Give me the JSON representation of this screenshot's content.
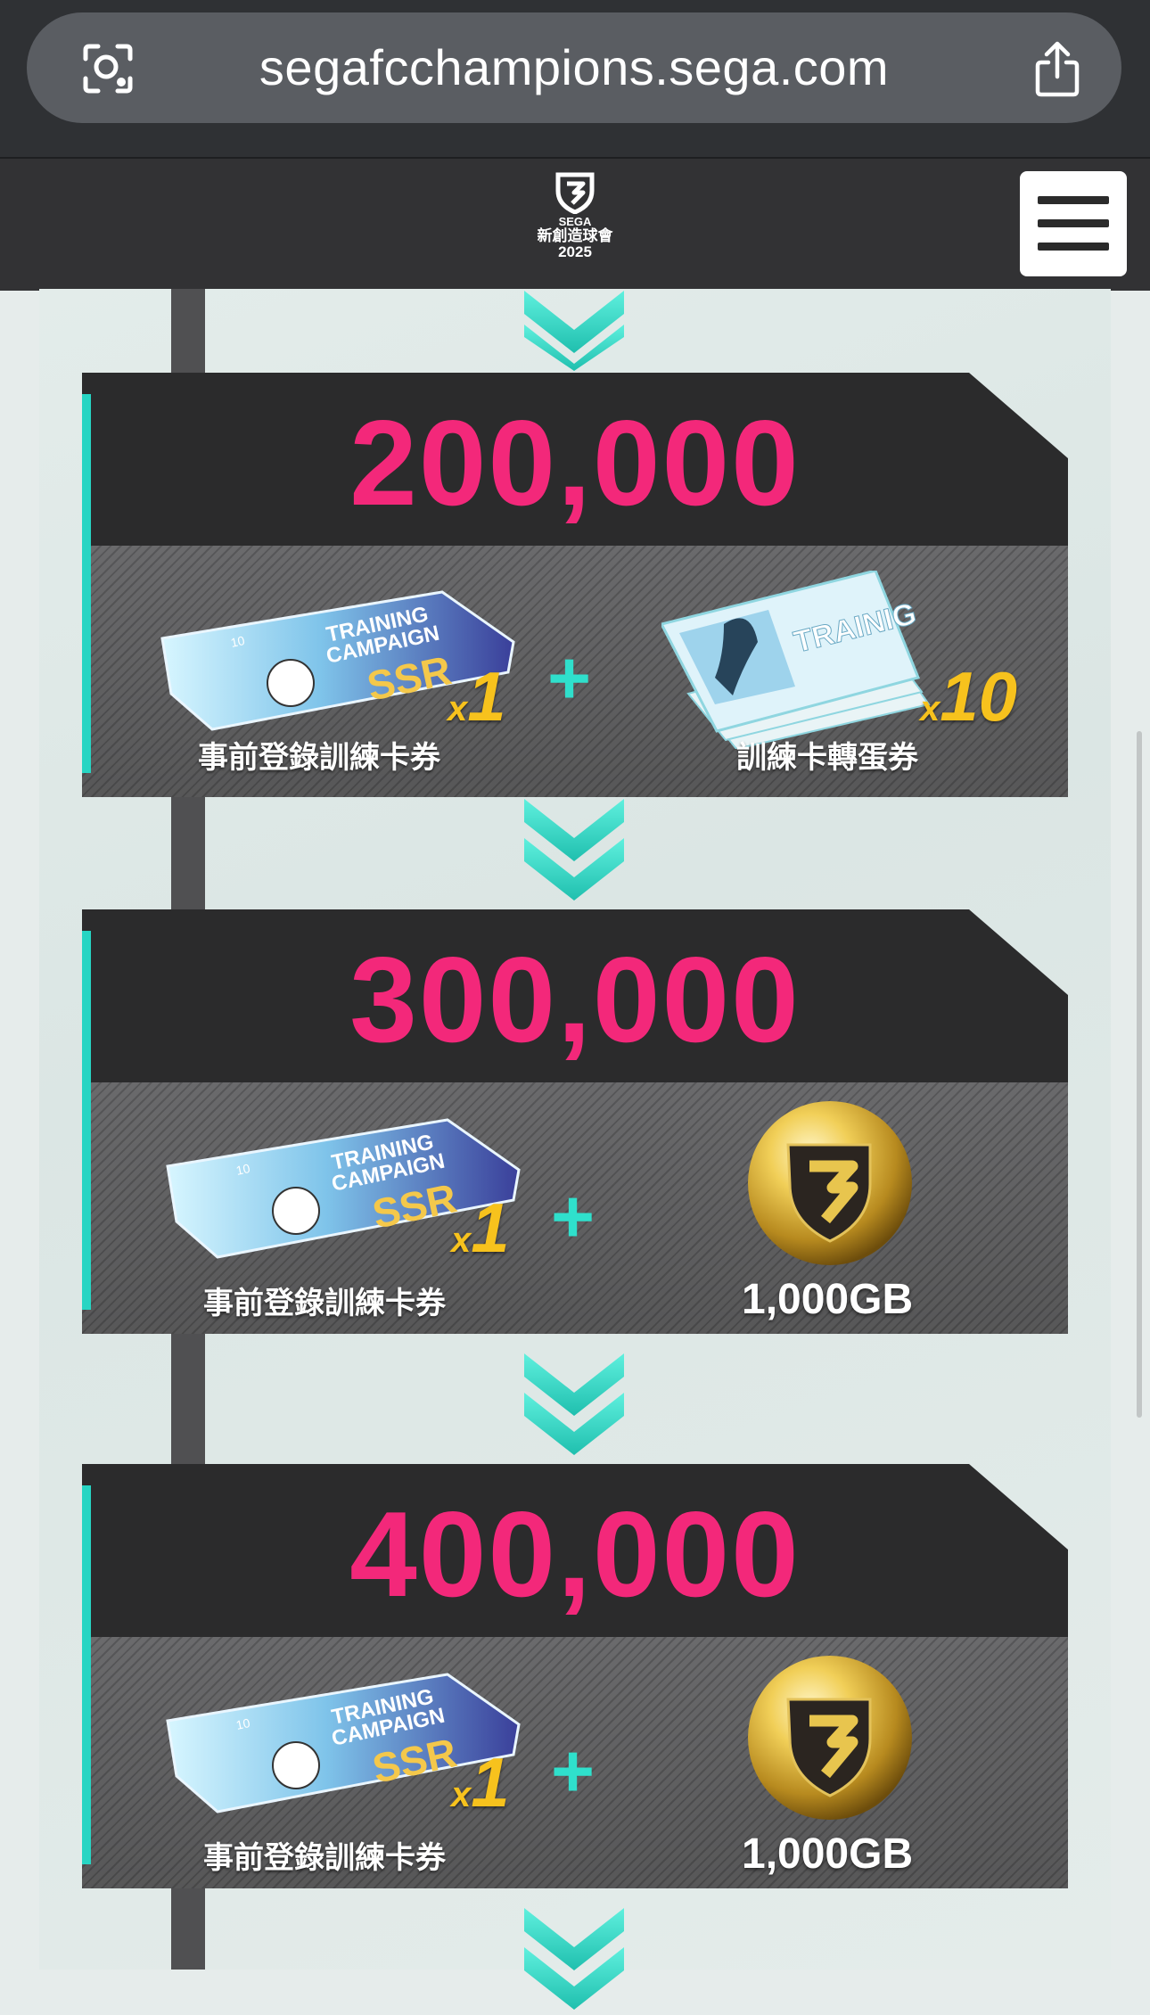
{
  "browser": {
    "url": "segafcchampions.sega.com"
  },
  "header": {
    "logo_top": "SEGA",
    "logo_cn": "新創造球會",
    "logo_year": "2025"
  },
  "tiers": [
    {
      "amount": "200,000",
      "left": {
        "label": "事前登錄訓練卡券",
        "qty_prefix": "x",
        "qty": "1",
        "ticket_text_1": "TRAINING",
        "ticket_text_2": "CAMPAIGN",
        "ticket_rarity": "SSR",
        "ticket_no": "10"
      },
      "right": {
        "label": "訓練卡轉蛋券",
        "qty_prefix": "x",
        "qty": "10",
        "ticket_text": "TRAINIG"
      }
    },
    {
      "amount": "300,000",
      "left": {
        "label": "事前登錄訓練卡券",
        "qty_prefix": "x",
        "qty": "1",
        "ticket_text_1": "TRAINING",
        "ticket_text_2": "CAMPAIGN",
        "ticket_rarity": "SSR",
        "ticket_no": "10"
      },
      "right": {
        "label": "1,000GB"
      }
    },
    {
      "amount": "400,000",
      "left": {
        "label": "事前登錄訓練卡券",
        "qty_prefix": "x",
        "qty": "1",
        "ticket_text_1": "TRAINING",
        "ticket_text_2": "CAMPAIGN",
        "ticket_rarity": "SSR",
        "ticket_no": "10"
      },
      "right": {
        "label": "1,000GB"
      }
    }
  ],
  "plus_symbol": "+",
  "colors": {
    "accent": "#27d5c3",
    "amount": "#f3287a",
    "qty": "#f7c21d"
  }
}
